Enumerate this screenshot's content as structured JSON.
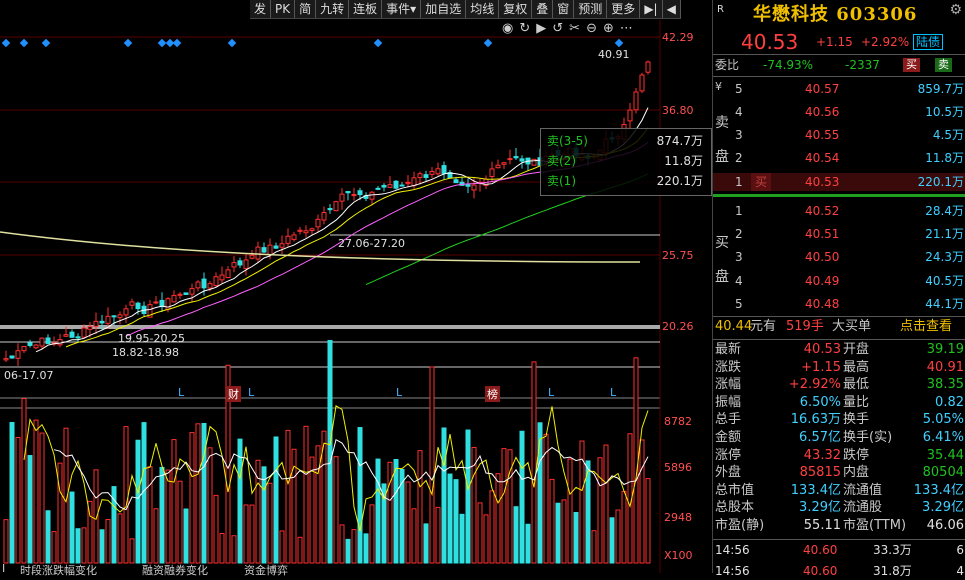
{
  "toolbar": {
    "items": [
      "发",
      "PK",
      "简",
      "九转",
      "连板",
      "事件▾",
      "加自选",
      "均线",
      "复权",
      "叠",
      "窗",
      "预测",
      "更多",
      "▶|",
      "◀"
    ]
  },
  "chart": {
    "price_labels": [
      "42.29",
      "36.80",
      "25.75",
      "20.26"
    ],
    "vol_labels": [
      "8782",
      "5896",
      "2948",
      "X100"
    ],
    "high_marker": "40.91",
    "ann1": "27.06-27.20",
    "ann2": "19.95-20.25",
    "ann3": "18.82-18.98",
    "ann4": "06-17.07",
    "markers": [
      "L",
      "财",
      "L",
      "L",
      "榜",
      "L",
      "L"
    ],
    "bottom_tabs": [
      "I",
      "时段涨跌幅变化",
      "融资融券变化",
      "资金博弈"
    ]
  },
  "popup": {
    "rows": [
      {
        "label": "卖(3-5)",
        "value": "874.7万"
      },
      {
        "label": "卖(2)",
        "value": "11.8万"
      },
      {
        "label": "卖(1)",
        "value": "220.1万"
      }
    ]
  },
  "quote": {
    "r_label": "R",
    "name": "华懋科技 603306",
    "price": "40.53",
    "change": "+1.15",
    "pct": "+2.92%",
    "hk": "陆债",
    "weibi_label": "委比",
    "weibi": "-74.93%",
    "weicha": "-2337",
    "buy_btn": "买",
    "sell_btn": "卖",
    "sell_label": [
      "卖",
      "盘"
    ],
    "buy_label": [
      "买",
      "盘"
    ],
    "sells": [
      {
        "idx": "5",
        "price": "40.57",
        "vol": "859.7万"
      },
      {
        "idx": "4",
        "price": "40.56",
        "vol": "10.5万"
      },
      {
        "idx": "3",
        "price": "40.55",
        "vol": "4.5万"
      },
      {
        "idx": "2",
        "price": "40.54",
        "vol": "11.8万"
      },
      {
        "idx": "1",
        "price": "40.53",
        "vol": "220.1万"
      }
    ],
    "buys": [
      {
        "idx": "1",
        "price": "40.52",
        "vol": "28.4万"
      },
      {
        "idx": "2",
        "price": "40.51",
        "vol": "21.1万"
      },
      {
        "idx": "3",
        "price": "40.50",
        "vol": "24.3万"
      },
      {
        "idx": "4",
        "price": "40.49",
        "vol": "40.5万"
      },
      {
        "idx": "5",
        "price": "40.48",
        "vol": "44.1万"
      }
    ],
    "big_order": {
      "price": "40.44",
      "unit": "元有",
      "hands": "519手",
      "type": "大买单",
      "link": "点击查看"
    },
    "stats": [
      {
        "l1": "最新",
        "v1": "40.53",
        "c1": "red",
        "l2": "开盘",
        "v2": "39.19",
        "c2": "green"
      },
      {
        "l1": "涨跌",
        "v1": "+1.15",
        "c1": "red",
        "l2": "最高",
        "v2": "40.91",
        "c2": "red"
      },
      {
        "l1": "涨幅",
        "v1": "+2.92%",
        "c1": "red",
        "l2": "最低",
        "v2": "38.35",
        "c2": "green"
      },
      {
        "l1": "振幅",
        "v1": "6.50%",
        "c1": "cyan",
        "l2": "量比",
        "v2": "0.82",
        "c2": "cyan"
      },
      {
        "l1": "总手",
        "v1": "16.63万",
        "c1": "cyan",
        "l2": "换手",
        "v2": "5.05%",
        "c2": "cyan"
      },
      {
        "l1": "金额",
        "v1": "6.57亿",
        "c1": "cyan",
        "l2": "换手(实)",
        "v2": "6.41%",
        "c2": "cyan"
      },
      {
        "l1": "涨停",
        "v1": "43.32",
        "c1": "red",
        "l2": "跌停",
        "v2": "35.44",
        "c2": "green"
      },
      {
        "l1": "外盘",
        "v1": "85815",
        "c1": "red",
        "l2": "内盘",
        "v2": "80504",
        "c2": "green"
      },
      {
        "l1": "总市值",
        "v1": "133.4亿",
        "c1": "cyan",
        "l2": "流通值",
        "v2": "133.4亿",
        "c2": "cyan"
      },
      {
        "l1": "总股本",
        "v1": "3.29亿",
        "c1": "cyan",
        "l2": "流通股",
        "v2": "3.29亿",
        "c2": "cyan"
      },
      {
        "l1": "市盈(静)",
        "v1": "55.11",
        "c1": "white",
        "l2": "市盈(TTM)",
        "v2": "46.06",
        "c2": "white"
      }
    ],
    "ticks": [
      {
        "time": "14:56",
        "price": "40.60",
        "vol": "33.3万",
        "n": "6"
      },
      {
        "time": "14:56",
        "price": "40.60",
        "vol": "31.8万",
        "n": "4"
      }
    ]
  }
}
